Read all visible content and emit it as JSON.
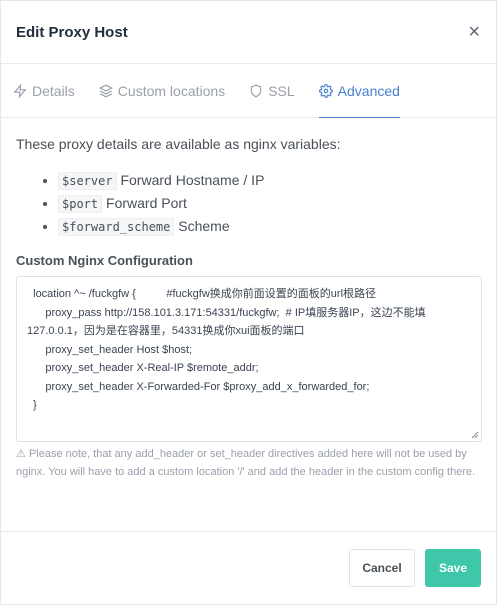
{
  "modal": {
    "title": "Edit Proxy Host",
    "close_label": "×"
  },
  "tabs": [
    {
      "label": "Details",
      "icon": "bolt-icon"
    },
    {
      "label": "Custom locations",
      "icon": "layers-icon"
    },
    {
      "label": "SSL",
      "icon": "shield-icon"
    },
    {
      "label": "Advanced",
      "icon": "gear-icon",
      "active": true
    }
  ],
  "advanced": {
    "intro": "These proxy details are available as nginx variables:",
    "variables": [
      {
        "code": "$server",
        "desc": "Forward Hostname / IP"
      },
      {
        "code": "$port",
        "desc": "Forward Port"
      },
      {
        "code": "$forward_scheme",
        "desc": "Scheme"
      }
    ],
    "config_label": "Custom Nginx Configuration",
    "config_value": "  location ^~ /fuckgfw {          #fuckgfw换成你前面设置的面板的url根路径\n      proxy_pass http://158.101.3.171:54331/fuckgfw;  # IP填服务器IP，这边不能填\n127.0.0.1，因为是在容器里，54331换成你xui面板的端口\n      proxy_set_header Host $host;\n      proxy_set_header X-Real-IP $remote_addr;\n      proxy_set_header X-Forwarded-For $proxy_add_x_forwarded_for;\n  }",
    "note": "Please note, that any add_header or set_header directives added here will not be used by nginx. You will have to add a custom location '/' and add the header in the custom config there."
  },
  "footer": {
    "cancel_label": "Cancel",
    "save_label": "Save"
  },
  "colors": {
    "accent": "#467fcf",
    "save": "#3ec7a8"
  }
}
